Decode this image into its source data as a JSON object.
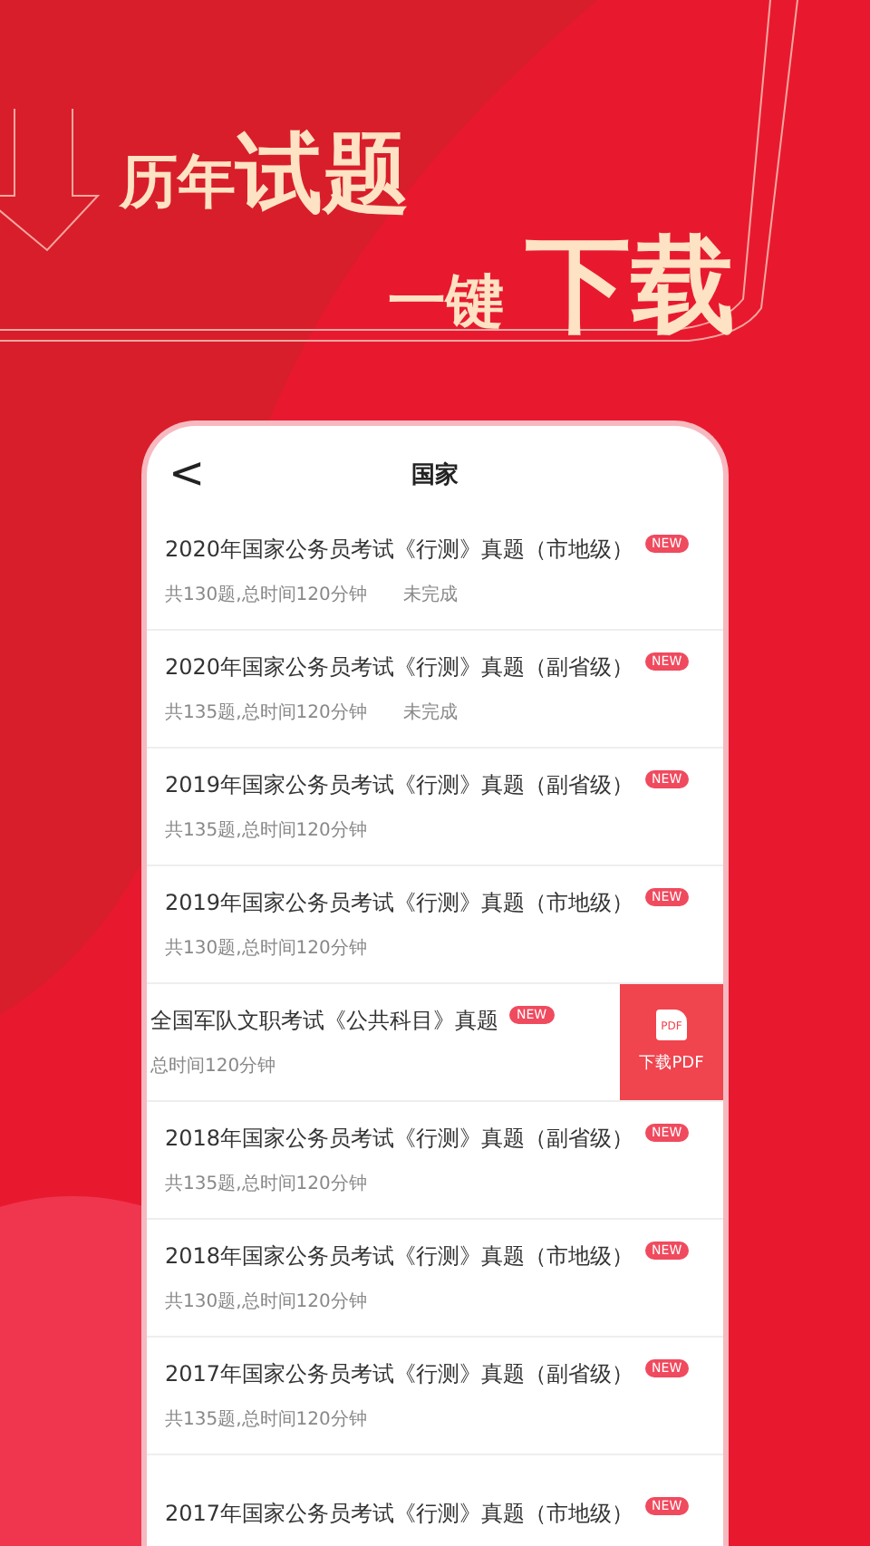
{
  "headline": [
    {
      "parts": [
        {
          "text": "历年",
          "kind": "small"
        },
        {
          "text": "试题",
          "kind": "large"
        }
      ]
    },
    {
      "parts": [
        {
          "text": "一键",
          "kind": "small"
        },
        {
          "text": "下载",
          "kind": "large"
        }
      ]
    }
  ],
  "screen": {
    "back": "<",
    "title": "国家",
    "rows": [
      {
        "kind": "normal",
        "title": "2020年国家公务员考试《行测》真题（市地级）",
        "badge": "NEW",
        "meta": "共130题,总时间120分钟",
        "status": "未完成"
      },
      {
        "kind": "normal",
        "title": "2020年国家公务员考试《行测》真题（副省级）",
        "badge": "NEW",
        "meta": "共135题,总时间120分钟",
        "status": "未完成"
      },
      {
        "kind": "normal",
        "title": "2019年国家公务员考试《行测》真题（副省级）",
        "badge": "NEW",
        "meta": "共135题,总时间120分钟"
      },
      {
        "kind": "normal",
        "title": "2019年国家公务员考试《行测》真题（市地级）",
        "badge": "NEW",
        "meta": "共130题,总时间120分钟"
      },
      {
        "kind": "swiped",
        "title": "全国军队文职考试《公共科目》真题",
        "badge": "NEW",
        "meta": "总时间120分钟",
        "action": "下载PDF",
        "action_icon": "PDF"
      },
      {
        "kind": "normal",
        "title": "2018年国家公务员考试《行测》真题（副省级）",
        "badge": "NEW",
        "meta": "共135题,总时间120分钟"
      },
      {
        "kind": "normal",
        "title": "2018年国家公务员考试《行测》真题（市地级）",
        "badge": "NEW",
        "meta": "共130题,总时间120分钟"
      },
      {
        "kind": "normal",
        "title": "2017年国家公务员考试《行测》真题（副省级）",
        "badge": "NEW",
        "meta": "共135题,总时间120分钟"
      },
      {
        "kind": "normal",
        "title": "2017年国家公务员考试《行测》真题（市地级）",
        "badge": "NEW"
      }
    ]
  }
}
